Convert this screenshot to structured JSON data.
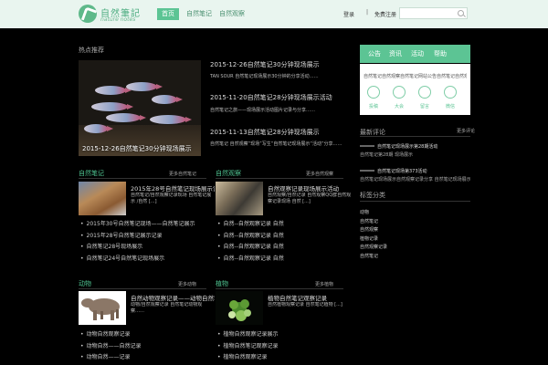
{
  "header": {
    "logo_cn": "自然筆記",
    "logo_en": "nature notes",
    "nav": [
      "首页",
      "自然笔记",
      "自然观察"
    ],
    "login": "登录",
    "separator": "|",
    "register": "免费注册",
    "search_placeholder": ""
  },
  "featured": {
    "title": "热点推荐",
    "hero_caption": "2015-12-26自然笔记30分钟现场展示",
    "news": [
      {
        "title": "2015-12-26自然笔记30分钟现场展示",
        "desc": "TAN SOUR 自然笔记现场展示30分钟的分享活动……"
      },
      {
        "title": "2015-11-20自然笔记28分钟现场展示活动",
        "desc": "自然笔记之旅——现场展示活动图片记录与分享……"
      },
      {
        "title": "2015-11-13自然笔记28分钟现场展示",
        "desc": "自然笔记 自然观察“现场”写生“自然笔记现场展示“活动”分享……"
      }
    ]
  },
  "sections": [
    {
      "title": "自然笔记",
      "more": "更多自然笔记",
      "headline": "2015年28号自然笔记现场展示记录",
      "desc": "自然笔记/自然观察记录现场 自然笔记展示 /自然 [...]",
      "items": [
        "2015年30号自然笔记现场——自然笔记展示",
        "2015年28号自然笔记展示记录",
        "自然笔记28号现场展示",
        "自然笔记24号自然笔记现场展示"
      ]
    },
    {
      "title": "自然观察",
      "more": "更多自然观察",
      "headline": "自然观察记录现场展示活动",
      "desc": "自然观察/自然记录 自然观察QQ群自然观察记录现场 自然 [...]",
      "items": [
        "自然--自然观察记录 自然",
        "自然--自然观察记录 自然",
        "自然--自然观察记录 自然",
        "自然--自然观察记录 自然"
      ]
    },
    {
      "title": "动物",
      "more": "更多动物",
      "headline": "自然动物观察记录——动物自然笔记记录",
      "desc": "动物/自然观察记录 自然笔记动物观察……",
      "items": [
        "动物自然观察记录",
        "动物自然——自然记录",
        "动物自然——记录"
      ]
    },
    {
      "title": "植物",
      "more": "更多植物",
      "headline": "植物自然笔记观察记录",
      "desc": "自然植物观察记录 自然笔记植物 [...]",
      "items": [
        "植物自然观察记录展示",
        "植物自然笔记观察记录",
        "植物自然观察记录"
      ]
    }
  ],
  "sidebar": {
    "tabs": [
      "公告",
      "资讯",
      "活动",
      "帮助"
    ],
    "notice": "自然笔记自然观察自然笔记网站公告自然笔记自然观察记录分享平台自然笔记……",
    "icons": [
      {
        "name": "user-icon",
        "label": "投稿"
      },
      {
        "name": "people-icon",
        "label": "大会"
      },
      {
        "name": "book-icon",
        "label": "留言"
      },
      {
        "name": "wechat-icon",
        "label": "微信"
      }
    ],
    "recent_title": "最新评论",
    "recent_more": "更多评论",
    "recent": [
      {
        "line1": "自然笔记现场展示第28期活动",
        "line2": "自然笔记第28期 现场展示"
      },
      {
        "line1": "自然笔记现场第373活动",
        "line2": "自然笔记现场展示自然观察记录分享 自然笔记现场展示活动自然笔记"
      }
    ],
    "tags_title": "标签分类",
    "tags": [
      "动物",
      "自然笔记",
      "自然观察",
      "植物记录",
      "自然观察记录",
      "自然笔记"
    ]
  }
}
